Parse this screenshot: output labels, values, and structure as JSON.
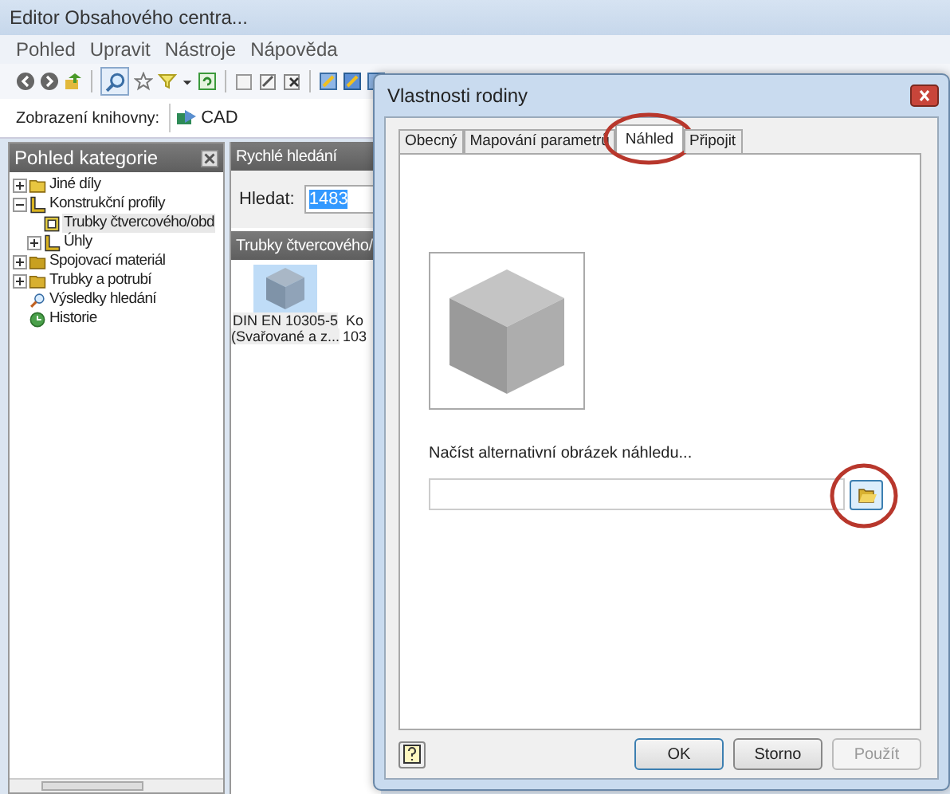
{
  "window": {
    "title": "Editor Obsahového centra..."
  },
  "menu": [
    "Pohled",
    "Upravit",
    "Nástroje",
    "Nápověda"
  ],
  "toolbar": {
    "search_selected": true
  },
  "library": {
    "label": "Zobrazení knihovny:",
    "value": "CAD"
  },
  "category_panel": {
    "title": "Pohled kategorie",
    "tree": [
      {
        "label": "Jiné díly",
        "kind": "folder",
        "expanded": false,
        "selected": false
      },
      {
        "label": "Konstrukční profily",
        "kind": "profile",
        "expanded": true,
        "selected": false,
        "children": [
          {
            "label": "Trubky čtvercového/obd",
            "kind": "tube",
            "selected": true
          },
          {
            "label": "Úhly",
            "kind": "profile",
            "expanded": false,
            "selected": false
          }
        ]
      },
      {
        "label": "Spojovací materiál",
        "kind": "fastener",
        "expanded": false,
        "selected": false
      },
      {
        "label": "Trubky a potrubí",
        "kind": "pipe",
        "expanded": false,
        "selected": false
      },
      {
        "label": "Výsledky hledání",
        "kind": "search",
        "selected": false
      },
      {
        "label": "Historie",
        "kind": "history",
        "selected": false
      }
    ]
  },
  "quick_search": {
    "title": "Rychlé hledání",
    "label": "Hledat:",
    "value": "1483"
  },
  "results": {
    "title": "Trubky čtvercového/",
    "items": [
      {
        "lines": [
          "DIN EN 10305-5",
          "(Svařované a z..."
        ],
        "selected": true,
        "thumbnail": true
      },
      {
        "lines": [
          "Ko",
          "103"
        ],
        "selected": false,
        "thumbnail": false
      }
    ]
  },
  "dialog": {
    "title": "Vlastnosti rodiny",
    "tabs": [
      {
        "label": "Obecný",
        "selected": false
      },
      {
        "label": "Mapování parametrů",
        "selected": false
      },
      {
        "label": "Náhled",
        "selected": true
      },
      {
        "label": "Připojit",
        "selected": false
      }
    ],
    "load_label": "Načíst alternativní obrázek náhledu...",
    "buttons": [
      {
        "label": "OK",
        "disabled": false,
        "default": true
      },
      {
        "label": "Storno",
        "disabled": false,
        "default": false
      },
      {
        "label": "Použít",
        "disabled": true,
        "default": false
      }
    ]
  }
}
